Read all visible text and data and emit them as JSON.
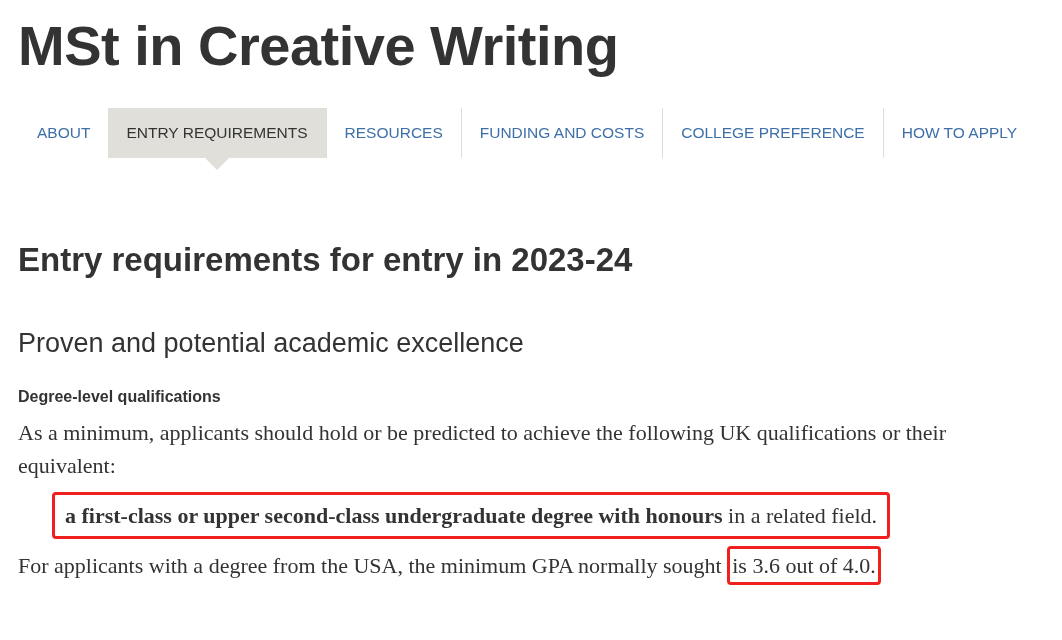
{
  "title": "MSt in Creative Writing",
  "tabs": [
    {
      "label": "ABOUT",
      "selected": false
    },
    {
      "label": "ENTRY REQUIREMENTS",
      "selected": true
    },
    {
      "label": "RESOURCES",
      "selected": false
    },
    {
      "label": "FUNDING AND COSTS",
      "selected": false
    },
    {
      "label": "COLLEGE PREFERENCE",
      "selected": false
    },
    {
      "label": "HOW TO APPLY",
      "selected": false
    }
  ],
  "heading": "Entry requirements for entry in 2023-24",
  "subheading": "Proven and potential academic excellence",
  "section_label": "Degree-level qualifications",
  "intro": "As a minimum, applicants should hold or be predicted to achieve the following UK qualifications or their equivalent:",
  "bullets": [
    {
      "text": "**a first-class or upper second-class undergraduate degree with honours** in a related field.",
      "highlighted": true
    }
  ],
  "gpa_note": [
    {
      "text": "For applicants with a degree from the USA, the minimum GPA normally sought ",
      "highlighted": false
    },
    {
      "text": "is 3.6 out of 4.0.",
      "highlighted": true
    }
  ]
}
